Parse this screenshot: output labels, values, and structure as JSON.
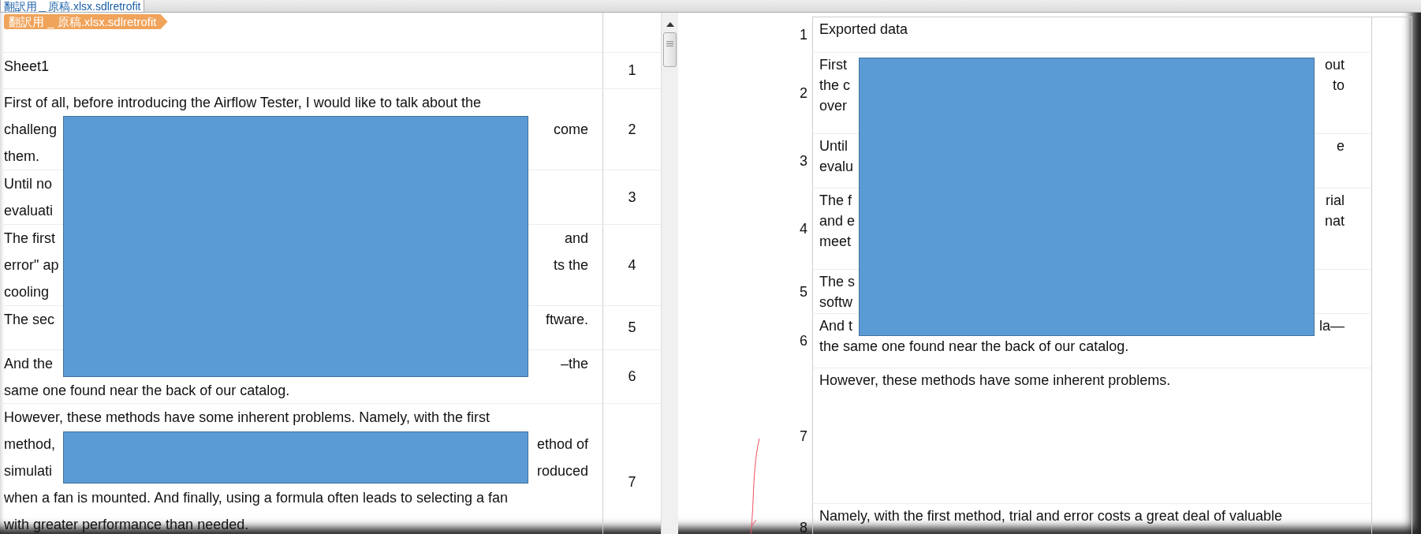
{
  "file_tab": {
    "label": "翻訳用＿原稿.xlsx.sdlretrofit",
    "selected": true
  },
  "breadcrumb": "翻訳用 _ 原稿.xlsx.sdlretrofit",
  "source": {
    "rows": [
      {
        "number": "1",
        "lines": [
          [
            "Sheet1"
          ]
        ]
      },
      {
        "number": "2",
        "lines": [
          [
            "First of all, before introducing the Airflow Tester, I would like to talk about the"
          ],
          [
            "challeng",
            "come"
          ],
          [
            "them."
          ]
        ]
      },
      {
        "number": "3",
        "lines": [
          [
            "Until no"
          ],
          [
            "evaluati"
          ]
        ]
      },
      {
        "number": "4",
        "lines": [
          [
            "The first",
            "and"
          ],
          [
            "error\" ap",
            "ts the"
          ],
          [
            "cooling"
          ]
        ]
      },
      {
        "number": "5",
        "lines": [
          [
            "The sec",
            "ftware."
          ]
        ]
      },
      {
        "number": "6",
        "lines": [
          [
            "And the",
            "–the"
          ],
          [
            "same one found near the back of our catalog."
          ]
        ]
      },
      {
        "number": "7",
        "lines": [
          [
            "However, these methods have some inherent problems. Namely, with the first"
          ],
          [
            "method,",
            "ethod of"
          ],
          [
            "simulati",
            "roduced"
          ],
          [
            "when a fan is mounted. And finally, using a formula often leads to selecting a fan"
          ],
          [
            "with greater performance than needed."
          ]
        ]
      }
    ]
  },
  "target": {
    "rows": [
      {
        "number": "1",
        "lines": [
          [
            "Exported data"
          ]
        ]
      },
      {
        "number": "2",
        "lines": [
          [
            "First",
            "out"
          ],
          [
            "the c",
            "to"
          ],
          [
            "over"
          ]
        ]
      },
      {
        "number": "3",
        "lines": [
          [
            "Until",
            "e"
          ],
          [
            "evalu"
          ]
        ]
      },
      {
        "number": "4",
        "lines": [
          [
            "The f",
            "rial"
          ],
          [
            "and e",
            "nat"
          ],
          [
            "meet"
          ]
        ]
      },
      {
        "number": "5",
        "lines": [
          [
            "The s"
          ],
          [
            "softw"
          ]
        ]
      },
      {
        "number": "6",
        "lines": [
          [
            "And t",
            "la—"
          ],
          [
            "the same one found near the back of our catalog."
          ]
        ]
      },
      {
        "number": "7",
        "lines": [
          [
            "However, these methods have some inherent problems."
          ]
        ]
      },
      {
        "number": "8",
        "lines": [
          [
            "Namely, with the first method, trial and error costs a great deal of valuable"
          ]
        ]
      }
    ]
  }
}
